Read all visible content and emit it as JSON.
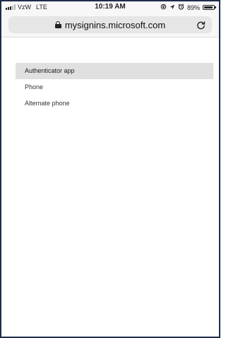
{
  "status_bar": {
    "carrier": "VzW",
    "network": "LTE",
    "time": "10:19 AM",
    "battery": "89%",
    "battery_level": 0.89,
    "icons": [
      "screen-lock-rotation-icon",
      "location-arrow-icon",
      "alarm-icon"
    ]
  },
  "address_bar": {
    "url": "mysignins.microsoft.com",
    "lock_icon": "lock-icon",
    "reload_icon": "reload-icon"
  },
  "menu": {
    "items": [
      {
        "label": "Authenticator app",
        "selected": true
      },
      {
        "label": "Phone",
        "selected": false
      },
      {
        "label": "Alternate phone",
        "selected": false
      }
    ],
    "selected_bg": "#e0e0e0"
  }
}
